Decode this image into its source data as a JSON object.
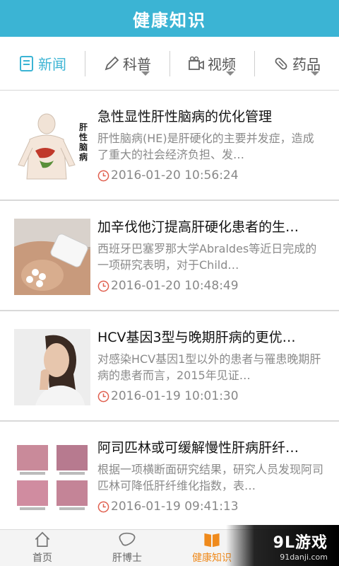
{
  "header": {
    "title": "健康知识"
  },
  "tabs": [
    {
      "label": "新闻",
      "icon": "news-icon",
      "active": true
    },
    {
      "label": "科普",
      "icon": "pencil-icon",
      "active": false
    },
    {
      "label": "视频",
      "icon": "video-icon",
      "active": false
    },
    {
      "label": "药品",
      "icon": "pill-icon",
      "active": false
    }
  ],
  "articles": [
    {
      "title": "急性显性肝性脑病的优化管理",
      "summary": "肝性脑病(HE)是肝硬化的主要并发症，造成了重大的社会经济负担、发…",
      "time": "2016-01-20 10:56:24",
      "thumb_text": "肝性脑病"
    },
    {
      "title": "加辛伐他汀提高肝硬化患者的生…",
      "summary": "西班牙巴塞罗那大学Abraldes等近日完成的一项研究表明，对于Child…",
      "time": "2016-01-20 10:48:49"
    },
    {
      "title": "HCV基因3型与晚期肝病的更优…",
      "summary": "对感染HCV基因1型以外的患者与罹患晚期肝病的患者而言，2015年见证…",
      "time": "2016-01-19 10:01:30"
    },
    {
      "title": "阿司匹林或可缓解慢性肝病肝纤…",
      "summary": "根据一项横断面研究结果，研究人员发现阿司匹林可降低肝纤维化指数，表…",
      "time": "2016-01-19 09:41:13"
    }
  ],
  "bottom_nav": [
    {
      "label": "首页",
      "icon": "home-icon",
      "active": false
    },
    {
      "label": "肝博士",
      "icon": "liver-icon",
      "active": false
    },
    {
      "label": "健康知识",
      "icon": "book-icon",
      "active": true
    }
  ],
  "watermark": {
    "main": "9L游戏",
    "sub": "91danji.com"
  },
  "colors": {
    "header": "#3bb4d4",
    "active_tab": "#3bb4d4",
    "active_nav": "#ef8a1c"
  }
}
